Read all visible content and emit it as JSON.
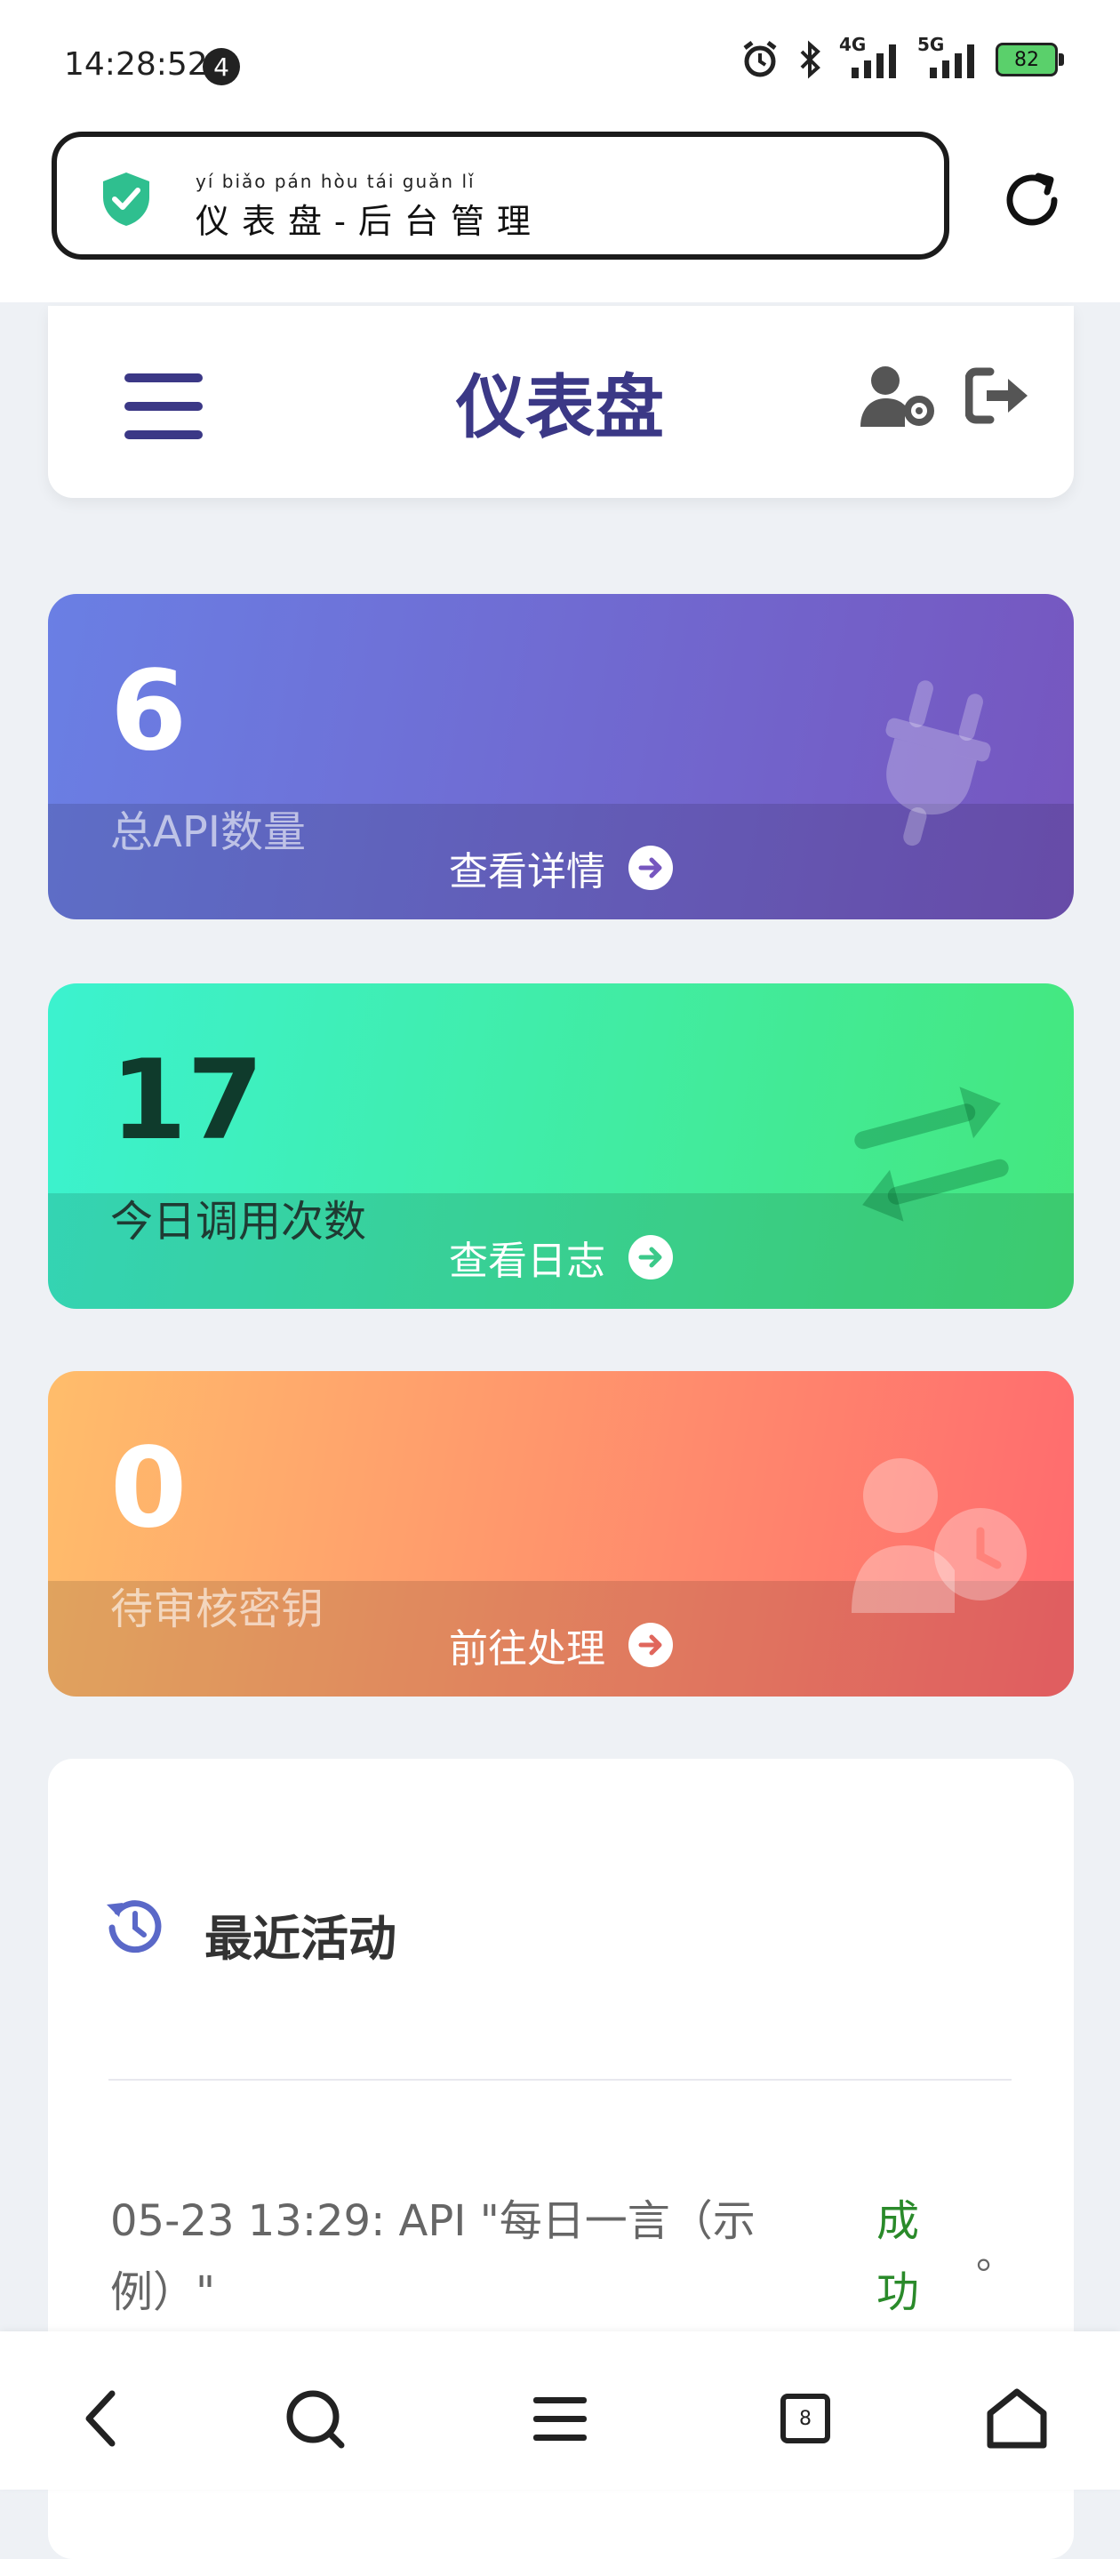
{
  "status_bar": {
    "time": "14:28:52",
    "notification_count": "4",
    "network_1": "4G",
    "network_2": "5G",
    "battery": "82"
  },
  "browser": {
    "page_title": "仪表盘-后台管理",
    "pinyin": "yí  biǎo  pán     hòu  tái  guǎn  lǐ",
    "secure_color": "#2fbf8f"
  },
  "header": {
    "title": "仪表盘"
  },
  "stats": [
    {
      "value": "6",
      "label": "总API数量",
      "link": "查看详情",
      "icon": "plug-icon"
    },
    {
      "value": "17",
      "label": "今日调用次数",
      "link": "查看日志",
      "icon": "exchange-arrows-icon"
    },
    {
      "value": "0",
      "label": "待审核密钥",
      "link": "前往处理",
      "icon": "user-clock-icon"
    }
  ],
  "activity": {
    "title": "最近活动",
    "items": [
      {
        "text": "05-23 13:29: API \"每日一言（示例）\"",
        "status": "成功",
        "suffix": "。"
      }
    ]
  },
  "bottom_nav": {
    "tabs_count": "8"
  },
  "colors": {
    "primary": "#3b3886",
    "card1": "#6a7fe4",
    "card2": "#3cf2cf",
    "card3": "#ff6a6e",
    "success": "#2a8a2a"
  }
}
